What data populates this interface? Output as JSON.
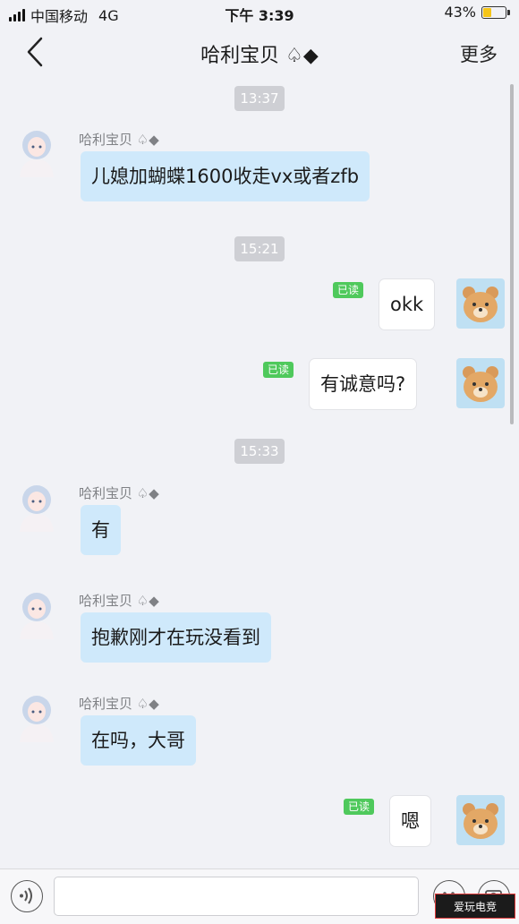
{
  "status_bar": {
    "carrier": "中国移动",
    "network": "4G",
    "time": "下午 3:39",
    "battery_percent": "43%",
    "battery_level": 0.43
  },
  "nav": {
    "title": "哈利宝贝 ♤◆",
    "more_label": "更多",
    "back_icon": "chevron-left-icon"
  },
  "timestamps": [
    "13:37",
    "15:21",
    "15:33"
  ],
  "sender_name": "哈利宝贝 ♤◆",
  "read_label": "已读",
  "messages": {
    "m1": "儿媳加蝴蝶1600收走vx或者zfb",
    "m2": "okk",
    "m3": "有诚意吗?",
    "m4": "有",
    "m5": "抱歉刚才在玩没看到",
    "m6": "在吗，大哥",
    "m7": "嗯"
  },
  "input_bar": {
    "placeholder": "",
    "voice_icon": "voice-icon",
    "emoji_icon": "emoji-icon",
    "camera_icon": "camera-icon"
  },
  "watermark": "爱玩电竞",
  "colors": {
    "incoming_bubble": "#cfe9fb",
    "outgoing_bubble": "#ffffff",
    "read_badge": "#4fc95c",
    "battery": "#f5c518"
  }
}
